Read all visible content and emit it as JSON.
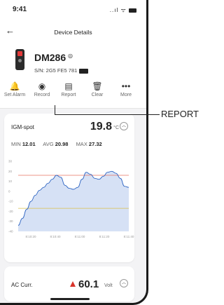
{
  "status": {
    "time": "9:41",
    "indicators": "..ıl ᯤ"
  },
  "topbar": {
    "back": "←",
    "title": "Device Details"
  },
  "device": {
    "name": "DM286",
    "serial": "S/N: 2G5 FE5 781"
  },
  "actions": [
    {
      "icon": "bell-icon",
      "glyph": "🔔",
      "label": "Set Alarm"
    },
    {
      "icon": "record-icon",
      "glyph": "◉",
      "label": "Record"
    },
    {
      "icon": "report-icon",
      "glyph": "▤",
      "label": "Report"
    },
    {
      "icon": "clear-icon",
      "glyph": "🗑",
      "label": "Clear"
    },
    {
      "icon": "more-icon",
      "glyph": "•••",
      "label": "More"
    }
  ],
  "card1": {
    "title": "IGM-spot",
    "value": "19.8",
    "unit": "°C",
    "stats": {
      "min_label": "MIN",
      "min": "12.01",
      "avg_label": "AVG",
      "avg": "20.98",
      "max_label": "MAX",
      "max": "27.32"
    }
  },
  "chart_data": {
    "type": "area",
    "title": "",
    "xlabel": "",
    "ylabel": "",
    "ylim": [
      -40,
      30
    ],
    "y_ticks": [
      30,
      20,
      10,
      0,
      -10,
      -20,
      -30,
      -40
    ],
    "x_ticks": [
      "8:10:20",
      "8:10:40",
      "8:11:00",
      "8:11:20",
      "8:11:40"
    ],
    "upper_limit": 16,
    "lower_limit": -17,
    "grid": false,
    "series": [
      {
        "values": [
          -34,
          -27,
          -18,
          -10,
          -4,
          1,
          4,
          8,
          12,
          16,
          14,
          6,
          3,
          2,
          4,
          12,
          19,
          17,
          13,
          12,
          15,
          19,
          20,
          18,
          13,
          5,
          4
        ]
      }
    ],
    "colors": {
      "line": "#2c63c2",
      "fill": "#cfdcf3",
      "upper": "#e8705f",
      "lower": "#d9c04a"
    }
  },
  "card2": {
    "title": "AC Curr.",
    "value": "60.1",
    "unit": "Volt"
  },
  "callout": {
    "label": "REPORT"
  }
}
